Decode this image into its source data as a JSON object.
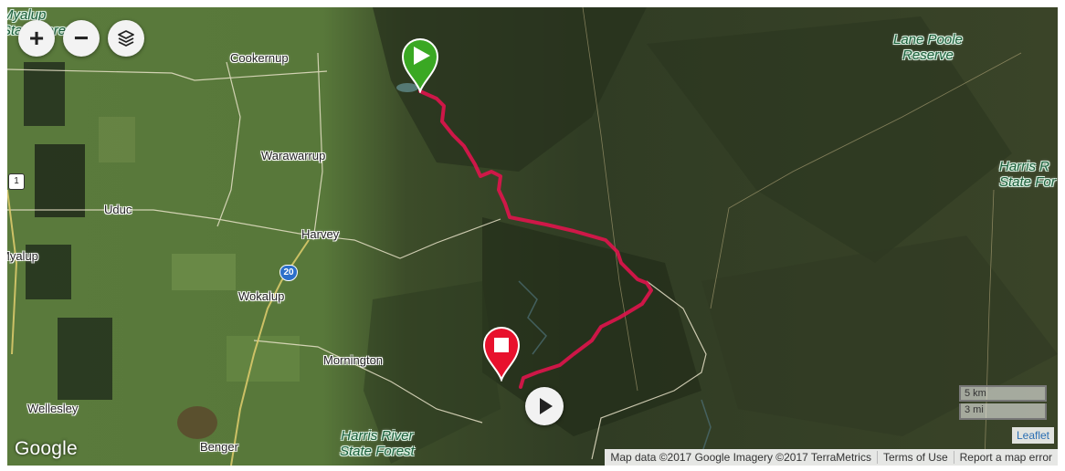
{
  "controls": {
    "zoom_in": "+",
    "zoom_out": "−",
    "layers_icon": "layers-icon"
  },
  "places": {
    "myalup_forest": "Myalup\nState Forest",
    "cookernup": "Cookernup",
    "lane_poole": "Lane Poole\nReserve",
    "warawarrup": "Warawarrup",
    "harris_range": "Harris R\nState For",
    "uduc": "Uduc",
    "harvey": "Harvey",
    "myalup": "Myalup",
    "wokalup": "Wokalup",
    "mornington": "Mornington",
    "wellesley": "Wellesley",
    "benger": "Benger",
    "harris_river": "Harris River\nState Forest"
  },
  "road_shields": {
    "route_1": "1",
    "route_20": "20"
  },
  "scale": {
    "metric": "5 km",
    "imperial": "3 mi"
  },
  "attribution": {
    "leaflet": "Leaflet",
    "map_data": "Map data ©2017 Google Imagery ©2017 TerraMetrics",
    "terms": "Terms of Use",
    "report": "Report a map error"
  },
  "branding": {
    "google": "Google"
  },
  "markers": {
    "start_icon": "play-triangle-icon",
    "end_icon": "stop-square-icon"
  },
  "colors": {
    "route": "#e0144c",
    "start_marker": "#3aa823",
    "end_marker": "#e8112d"
  }
}
